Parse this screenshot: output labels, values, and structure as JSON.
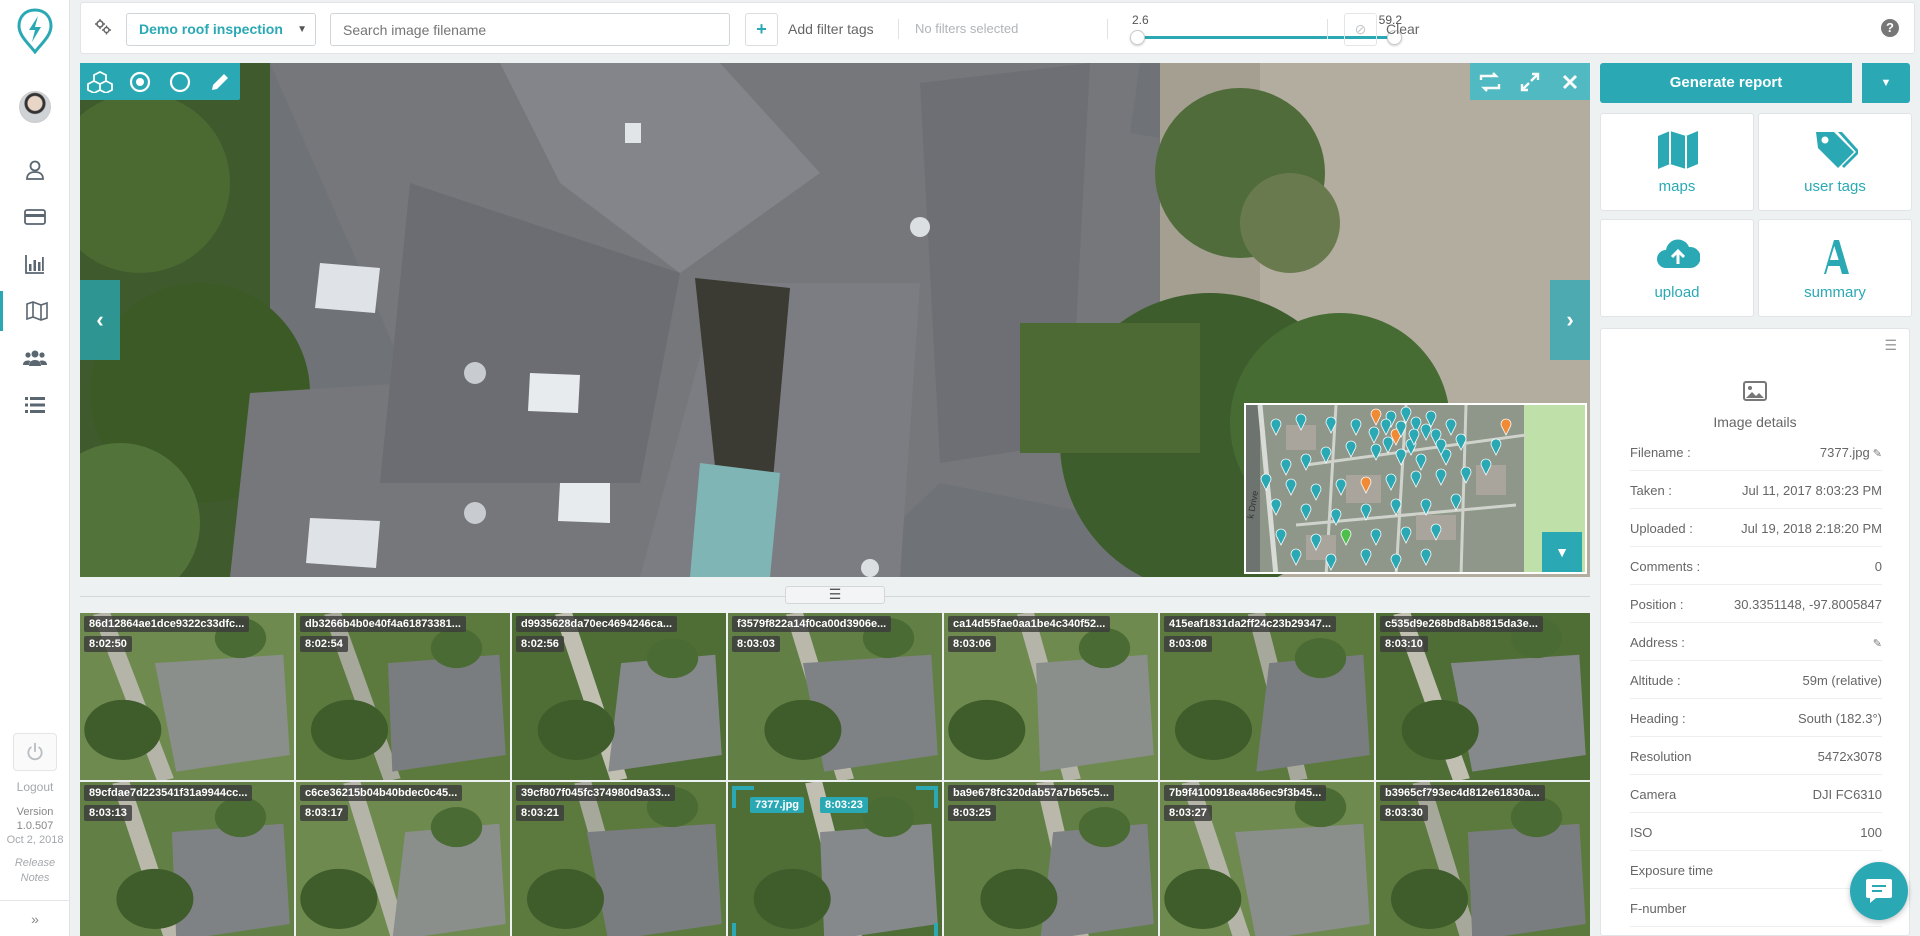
{
  "nav": {
    "logout_label": "Logout",
    "version_label": "Version",
    "version_number": "1.0.507",
    "version_date": "Oct 2, 2018",
    "release_notes_label": "Release Notes",
    "collapse_label": "»",
    "items": [
      {
        "icon": "user-icon"
      },
      {
        "icon": "credit-card-icon"
      },
      {
        "icon": "bar-chart-icon"
      },
      {
        "icon": "map-icon",
        "active": true
      },
      {
        "icon": "users-icon"
      },
      {
        "icon": "list-icon"
      }
    ]
  },
  "topbar": {
    "project_selected": "Demo roof inspection",
    "search_placeholder": "Search image filename",
    "add_tag_symbol": "+",
    "add_tag_label": "Add filter tags",
    "no_filters_label": "No filters selected",
    "altitude_min": "2.6",
    "altitude_max": "59.2",
    "altitude_range_fraction": [
      0.0,
      1.0
    ],
    "clear_label": "Clear",
    "help_label": "?"
  },
  "viewer": {
    "prev_label": "‹",
    "next_label": "›"
  },
  "thumbnails": [
    {
      "name": "86d12864ae1dce9322c33dfc...",
      "time": "8:02:50"
    },
    {
      "name": "db3266b4b0e40f4a61873381...",
      "time": "8:02:54"
    },
    {
      "name": "d9935628da70ec4694246ca...",
      "time": "8:02:56"
    },
    {
      "name": "f3579f822a14f0ca00d3906e...",
      "time": "8:03:03"
    },
    {
      "name": "ca14d55fae0aa1be4c340f52...",
      "time": "8:03:06"
    },
    {
      "name": "415eaf1831da2ff24c23b29347...",
      "time": "8:03:08"
    },
    {
      "name": "c535d9e268bd8ab8815da3e...",
      "time": "8:03:10"
    },
    {
      "name": "89cfdae7d223541f31a9944cc...",
      "time": "8:03:13"
    },
    {
      "name": "c6ce36215b04b40bdec0c45...",
      "time": "8:03:17"
    },
    {
      "name": "39cf807f045fc374980d9a33...",
      "time": "8:03:21"
    },
    {
      "name": "7377.jpg",
      "time": "8:03:23",
      "selected": true
    },
    {
      "name": "ba9e678fc320dab57a7b65c5...",
      "time": "8:03:25"
    },
    {
      "name": "7b9f4100918ea486ec9f3b45...",
      "time": "8:03:27"
    },
    {
      "name": "b3965cf793ec4d812e61830a...",
      "time": "8:03:30"
    }
  ],
  "right": {
    "generate_report_label": "Generate report",
    "cards": [
      {
        "label": "maps",
        "icon": "map-icon"
      },
      {
        "label": "user tags",
        "icon": "tags-icon"
      },
      {
        "label": "upload",
        "icon": "cloud-upload-icon"
      },
      {
        "label": "summary",
        "icon": "summary-icon"
      }
    ],
    "details": {
      "title": "Image details",
      "rows": [
        {
          "key": "Filename :",
          "value": "7377.jpg",
          "editable": true
        },
        {
          "key": "Taken :",
          "value": "Jul 11, 2017 8:03:23 PM"
        },
        {
          "key": "Uploaded :",
          "value": "Jul 19, 2018 2:18:20 PM"
        },
        {
          "key": "Comments :",
          "value": "0"
        },
        {
          "key": "Position :",
          "value": "30.3351148, -97.8005847"
        },
        {
          "key": "Address :",
          "value": "",
          "editable": true
        },
        {
          "key": "Altitude :",
          "value": "59m (relative)"
        },
        {
          "key": "Heading :",
          "value": "South (182.3°)"
        },
        {
          "key": "Resolution",
          "value": "5472x3078"
        },
        {
          "key": "Camera",
          "value": "DJI FC6310"
        },
        {
          "key": "ISO",
          "value": "100"
        },
        {
          "key": "Exposure time",
          "value": ""
        },
        {
          "key": "F-number",
          "value": ""
        }
      ]
    }
  },
  "colors": {
    "accent": "#2aa9b5",
    "marker_orange": "#f08a35",
    "marker_green": "#4cc04a"
  }
}
